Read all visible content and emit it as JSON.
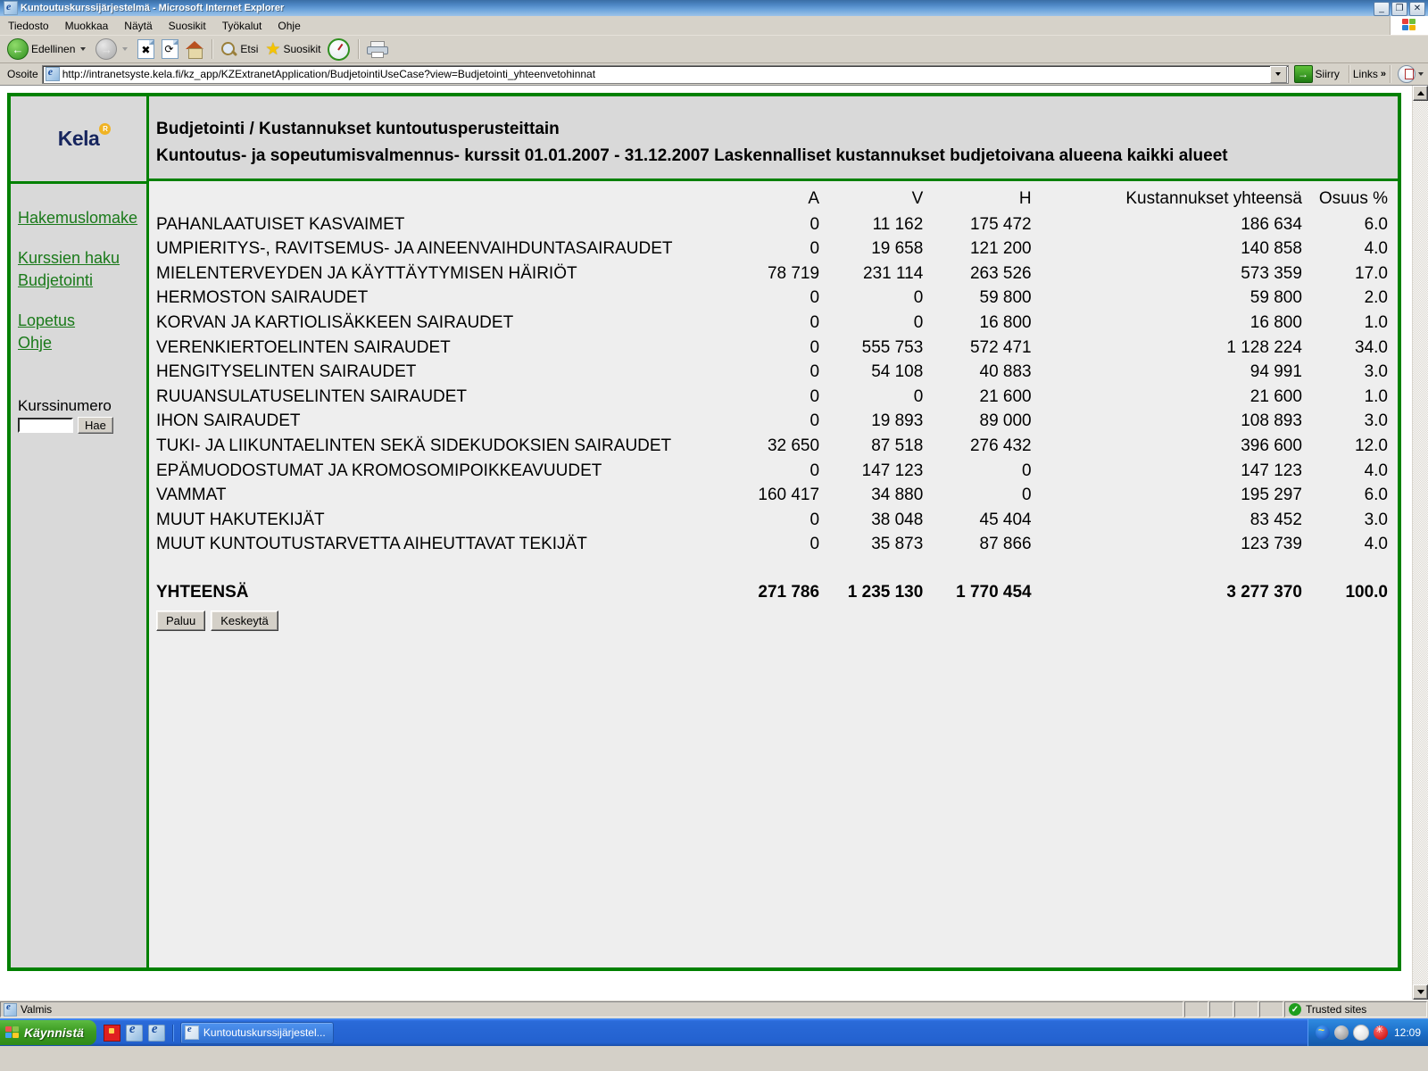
{
  "window": {
    "title": "Kuntoutuskurssijärjestelmä - Microsoft Internet Explorer",
    "minimize": "_",
    "maximize": "❐",
    "close": "✕"
  },
  "menu": {
    "items": [
      "Tiedosto",
      "Muokkaa",
      "Näytä",
      "Suosikit",
      "Työkalut",
      "Ohje"
    ]
  },
  "toolbar": {
    "back": "Edellinen",
    "forward": "",
    "stop": "✖",
    "refresh": "⟳",
    "home": "",
    "search": "Etsi",
    "favorites": "Suosikit",
    "history": "",
    "print": ""
  },
  "address": {
    "label": "Osoite",
    "url": "http://intranetsyste.kela.fi/kz_app/KZExtranetApplication/BudjetointiUseCase?view=Budjetointi_yhteenvetohinnat",
    "go": "Siirry",
    "links": "Links",
    "overflow": "»"
  },
  "sidebar": {
    "logo": "Kela",
    "logo_mark": "Ⓡ",
    "links": [
      "Hakemuslomake",
      "Kurssien haku",
      "Budjetointi",
      "Lopetus",
      "Ohje"
    ],
    "course_number_label": "Kurssinumero",
    "course_number_value": "",
    "search_button": "Hae"
  },
  "header": {
    "line1": "Budjetointi / Kustannukset kuntoutusperusteittain",
    "line2": "Kuntoutus- ja sopeutumisvalmennus- kurssit 01.01.2007 - 31.12.2007 Laskennalliset kustannukset budjetoivana alueena kaikki alueet"
  },
  "table": {
    "columns": [
      "",
      "A",
      "V",
      "H",
      "Kustannukset yhteensä",
      "Osuus %"
    ],
    "rows": [
      {
        "name": "PAHANLAATUISET KASVAIMET",
        "a": "0",
        "v": "11 162",
        "h": "175 472",
        "total": "186 634",
        "pct": "6.0"
      },
      {
        "name": "UMPIERITYS-, RAVITSEMUS- JA AINEENVAIHDUNTASAIRAUDET",
        "a": "0",
        "v": "19 658",
        "h": "121 200",
        "total": "140 858",
        "pct": "4.0"
      },
      {
        "name": "MIELENTERVEYDEN JA KÄYTTÄYTYMISEN HÄIRIÖT",
        "a": "78 719",
        "v": "231 114",
        "h": "263 526",
        "total": "573 359",
        "pct": "17.0"
      },
      {
        "name": "HERMOSTON SAIRAUDET",
        "a": "0",
        "v": "0",
        "h": "59 800",
        "total": "59 800",
        "pct": "2.0"
      },
      {
        "name": "KORVAN JA KARTIOLISÄKKEEN SAIRAUDET",
        "a": "0",
        "v": "0",
        "h": "16 800",
        "total": "16 800",
        "pct": "1.0"
      },
      {
        "name": "VERENKIERTOELINTEN SAIRAUDET",
        "a": "0",
        "v": "555 753",
        "h": "572 471",
        "total": "1 128 224",
        "pct": "34.0"
      },
      {
        "name": "HENGITYSELINTEN SAIRAUDET",
        "a": "0",
        "v": "54 108",
        "h": "40 883",
        "total": "94 991",
        "pct": "3.0"
      },
      {
        "name": "RUUANSULATUSELINTEN SAIRAUDET",
        "a": "0",
        "v": "0",
        "h": "21 600",
        "total": "21 600",
        "pct": "1.0"
      },
      {
        "name": "IHON SAIRAUDET",
        "a": "0",
        "v": "19 893",
        "h": "89 000",
        "total": "108 893",
        "pct": "3.0"
      },
      {
        "name": "TUKI- JA LIIKUNTAELINTEN SEKÄ SIDEKUDOKSIEN SAIRAUDET",
        "a": "32 650",
        "v": "87 518",
        "h": "276 432",
        "total": "396 600",
        "pct": "12.0"
      },
      {
        "name": "EPÄMUODOSTUMAT JA KROMOSOMIPOIKKEAVUUDET",
        "a": "0",
        "v": "147 123",
        "h": "0",
        "total": "147 123",
        "pct": "4.0"
      },
      {
        "name": "VAMMAT",
        "a": "160 417",
        "v": "34 880",
        "h": "0",
        "total": "195 297",
        "pct": "6.0"
      },
      {
        "name": "MUUT HAKUTEKIJÄT",
        "a": "0",
        "v": "38 048",
        "h": "45 404",
        "total": "83 452",
        "pct": "3.0"
      },
      {
        "name": "MUUT KUNTOUTUSTARVETTA AIHEUTTAVAT TEKIJÄT",
        "a": "0",
        "v": "35 873",
        "h": "87 866",
        "total": "123 739",
        "pct": "4.0"
      }
    ],
    "totals": {
      "name": "YHTEENSÄ",
      "a": "271 786",
      "v": "1 235 130",
      "h": "1 770 454",
      "total": "3 277 370",
      "pct": "100.0"
    }
  },
  "buttons": {
    "back": "Paluu",
    "cancel": "Keskeytä"
  },
  "statusbar": {
    "text": "Valmis",
    "zone": "Trusted sites"
  },
  "taskbar": {
    "start": "Käynnistä",
    "window": "Kuntoutuskurssijärjestel...",
    "clock": "12:09"
  },
  "colors": {
    "frame_green": "#008000",
    "link_green": "#1a7a1a",
    "kela_navy": "#17255e",
    "kela_gold": "#f0b323"
  }
}
